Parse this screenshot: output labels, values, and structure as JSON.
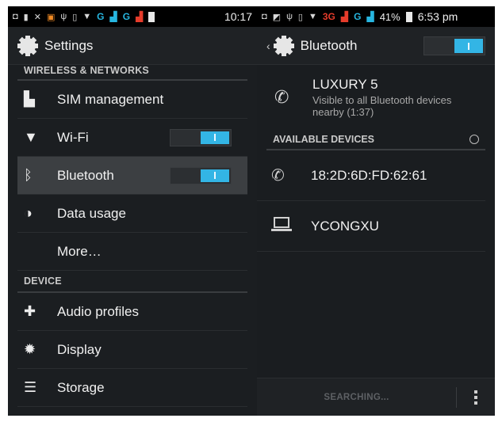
{
  "left_status": {
    "icons": [
      "notif-icon",
      "sd-icon",
      "usb-debug-icon",
      "app-icon",
      "usb-icon",
      "vibrate-icon",
      "wifi-icon"
    ],
    "sig1": "G",
    "sig2": "G",
    "time": "10:17"
  },
  "right_status": {
    "sig1": "3G",
    "sig2": "G",
    "battery": "41%",
    "time": "6:53 pm"
  },
  "settings": {
    "title": "Settings",
    "wireless_header": "WIRELESS & NETWORKS",
    "device_header": "DEVICE",
    "items": [
      {
        "label": "SIM management",
        "icon": "sim-icon"
      },
      {
        "label": "Wi-Fi",
        "icon": "wifi-icon",
        "toggle": "on"
      },
      {
        "label": "Bluetooth",
        "icon": "bluetooth-icon",
        "toggle": "on",
        "selected": true
      },
      {
        "label": "Data usage",
        "icon": "data-usage-icon"
      },
      {
        "label": "More…"
      }
    ],
    "device_items": [
      {
        "label": "Audio profiles",
        "icon": "audio-icon"
      },
      {
        "label": "Display",
        "icon": "display-icon"
      },
      {
        "label": "Storage",
        "icon": "storage-icon"
      }
    ]
  },
  "bluetooth": {
    "title": "Bluetooth",
    "toggle": "on",
    "self_name": "LUXURY 5",
    "self_sub": "Visible to all Bluetooth devices nearby (1:37)",
    "available_header": "AVAILABLE DEVICES",
    "devices": [
      {
        "label": "18:2D:6D:FD:62:61",
        "icon": "phone-icon"
      },
      {
        "label": "YCONGXU",
        "icon": "laptop-icon"
      }
    ],
    "searching_label": "SEARCHING..."
  },
  "colors": {
    "accent": "#33b5e5",
    "background": "#1b1e21"
  }
}
